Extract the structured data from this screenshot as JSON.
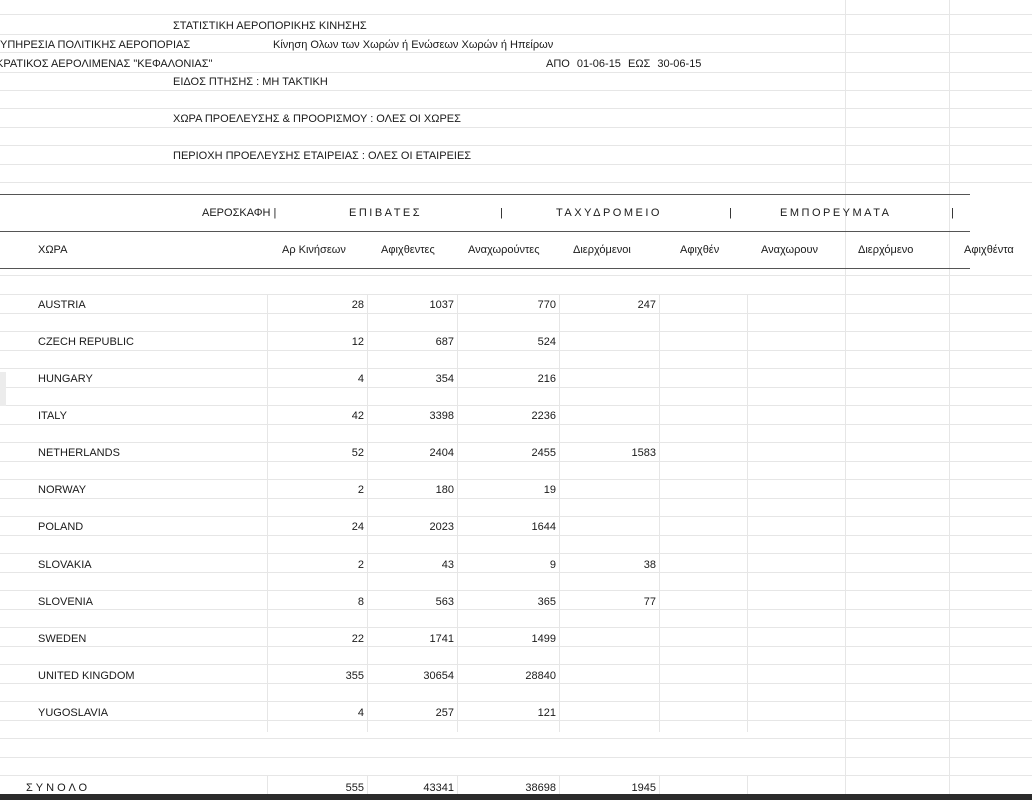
{
  "header": {
    "title": "ΣΤΑΤΙΣΤΙΚΗ ΑΕΡΟΠΟΡΙΚΗΣ ΚΙΝΗΣΗΣ",
    "org_line": "ΥΠΗΡΕΣΙΑ ΠΟΛΙΤΙΚΗΣ ΑΕΡΟΠΟΡΙΑΣ",
    "movement_desc": "Κίνηση Ολων των Χωρών ή Ενώσεων Χωρών ή Ηπείρων",
    "airport_line": "ΚΡΑΤΙΚΟΣ ΑΕΡΟΛΙΜΕΝΑΣ \"ΚΕΦΑΛΟΝΙΑΣ\"",
    "period": "ΑΠΟ 01-06-15 ΕΩΣ 30-06-15",
    "flight_type": "ΕΙΔΟΣ ΠΤΗΣΗΣ : ΜΗ ΤΑΚΤΙΚΗ",
    "country_filter": "ΧΩΡΑ ΠΡΟΕΛΕΥΣΗΣ & ΠΡΟΟΡΙΣΜΟΥ : ΟΛΕΣ ΟΙ ΧΩΡΕΣ",
    "company_filter": "ΠΕΡΙΟΧΗ ΠΡΟΕΛΕΥΣΗΣ ΕΤΑΙΡΕΙΑΣ : ΟΛΕΣ ΟΙ ΕΤΑΙΡΕΙΕΣ"
  },
  "groups": {
    "aircraft": "ΑΕΡΟΣΚΑΦΗ |",
    "passengers": "ΕΠΙΒΑΤΕΣ",
    "sep1": "|",
    "mail": "ΤΑΧΥΔΡΟΜΕΙΟ",
    "sep2": "|",
    "cargo": "ΕΜΠΟΡΕΥΜΑΤΑ",
    "sep3": "|"
  },
  "columns": {
    "country": "ΧΩΡΑ",
    "movements": "Αρ Κινήσεων",
    "pax_arrivals": "Αφιχθεντες",
    "pax_departures": "Αναχωρούντες",
    "pax_transit": "Διερχόμενοι",
    "mail_arrived": "Αφιχθέν",
    "mail_departing": "Αναχωρουν",
    "mail_transit": "Διερχόμενο",
    "cargo_arrived": "Αφιχθέντα"
  },
  "rows": [
    {
      "country": "AUSTRIA",
      "movements": "28",
      "arrivals": "1037",
      "departures": "770",
      "transit": "247"
    },
    {
      "country": "CZECH REPUBLIC",
      "movements": "12",
      "arrivals": "687",
      "departures": "524",
      "transit": ""
    },
    {
      "country": "HUNGARY",
      "movements": "4",
      "arrivals": "354",
      "departures": "216",
      "transit": ""
    },
    {
      "country": "ITALY",
      "movements": "42",
      "arrivals": "3398",
      "departures": "2236",
      "transit": ""
    },
    {
      "country": "NETHERLANDS",
      "movements": "52",
      "arrivals": "2404",
      "departures": "2455",
      "transit": "1583"
    },
    {
      "country": "NORWAY",
      "movements": "2",
      "arrivals": "180",
      "departures": "19",
      "transit": ""
    },
    {
      "country": "POLAND",
      "movements": "24",
      "arrivals": "2023",
      "departures": "1644",
      "transit": ""
    },
    {
      "country": "SLOVAKIA",
      "movements": "2",
      "arrivals": "43",
      "departures": "9",
      "transit": "38"
    },
    {
      "country": "SLOVENIA",
      "movements": "8",
      "arrivals": "563",
      "departures": "365",
      "transit": "77"
    },
    {
      "country": "SWEDEN",
      "movements": "22",
      "arrivals": "1741",
      "departures": "1499",
      "transit": ""
    },
    {
      "country": "UNITED KINGDOM",
      "movements": "355",
      "arrivals": "30654",
      "departures": "28840",
      "transit": ""
    },
    {
      "country": "YUGOSLAVIA",
      "movements": "4",
      "arrivals": "257",
      "departures": "121",
      "transit": ""
    }
  ],
  "total": {
    "label": "ΣΥΝΟΛΟ",
    "movements": "555",
    "arrivals": "43341",
    "departures": "38698",
    "transit": "1945"
  }
}
